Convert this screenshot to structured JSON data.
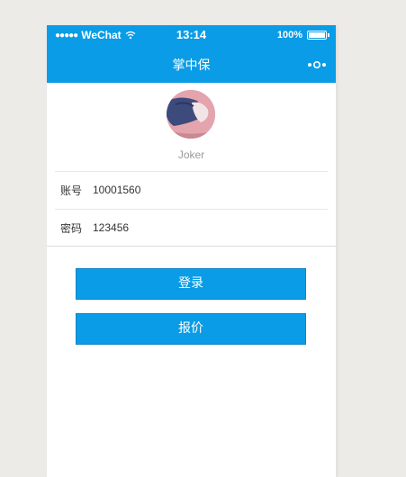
{
  "status_bar": {
    "carrier": "WeChat",
    "time": "13:14",
    "battery": "100%"
  },
  "nav": {
    "title": "掌中保"
  },
  "profile": {
    "username": "Joker"
  },
  "form": {
    "account_label": "账号",
    "account_value": "10001560",
    "password_label": "密码",
    "password_value": "123456"
  },
  "buttons": {
    "login_label": "登录",
    "quote_label": "报价"
  },
  "colors": {
    "primary": "#0a9ce6",
    "background": "#ecebe8"
  }
}
